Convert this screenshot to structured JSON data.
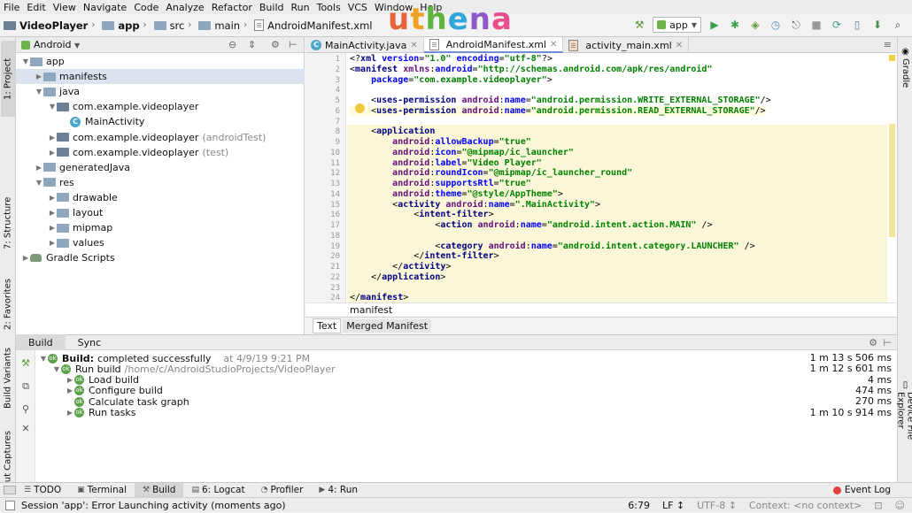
{
  "menu": [
    "File",
    "Edit",
    "View",
    "Navigate",
    "Code",
    "Analyze",
    "Refactor",
    "Build",
    "Run",
    "Tools",
    "VCS",
    "Window",
    "Help"
  ],
  "breadcrumbs": [
    "VideoPlayer",
    "app",
    "src",
    "main",
    "AndroidManifest.xml"
  ],
  "logo": "uthena",
  "run_config": "app",
  "left_strip": {
    "project": "1: Project",
    "structure": "7: Structure",
    "favorites": "2: Favorites",
    "build_variants": "Build Variants",
    "layout_captures": "Layout Captures"
  },
  "right_strip": {
    "gradle": "Gradle",
    "device_explorer": "Device File Explorer"
  },
  "project_panel": {
    "view_selector": "Android",
    "tree": [
      {
        "label": "app",
        "indent": 0,
        "type": "folder"
      },
      {
        "label": "manifests",
        "indent": 1,
        "type": "folder",
        "selected": true
      },
      {
        "label": "java",
        "indent": 1,
        "type": "folder"
      },
      {
        "label": "com.example.videoplayer",
        "indent": 2,
        "type": "package"
      },
      {
        "label": "MainActivity",
        "indent": 3,
        "type": "class"
      },
      {
        "label": "com.example.videoplayer",
        "suffix": "(androidTest)",
        "indent": 2,
        "type": "package"
      },
      {
        "label": "com.example.videoplayer",
        "suffix": "(test)",
        "indent": 2,
        "type": "package"
      },
      {
        "label": "generatedJava",
        "indent": 1,
        "type": "folder"
      },
      {
        "label": "res",
        "indent": 1,
        "type": "folder"
      },
      {
        "label": "drawable",
        "indent": 2,
        "type": "folder"
      },
      {
        "label": "layout",
        "indent": 2,
        "type": "folder"
      },
      {
        "label": "mipmap",
        "indent": 2,
        "type": "folder"
      },
      {
        "label": "values",
        "indent": 2,
        "type": "folder"
      },
      {
        "label": "Gradle Scripts",
        "indent": 0,
        "type": "gradle"
      }
    ]
  },
  "editor_tabs": [
    {
      "label": "MainActivity.java",
      "active": false
    },
    {
      "label": "AndroidManifest.xml",
      "active": true
    },
    {
      "label": "activity_main.xml",
      "active": false
    }
  ],
  "code_lines": [
    "<?xml version=\"1.0\" encoding=\"utf-8\"?>",
    "<manifest xmlns:android=\"http://schemas.android.com/apk/res/android\"",
    "    package=\"com.example.videoplayer\">",
    "",
    "    <uses-permission android:name=\"android.permission.WRITE_EXTERNAL_STORAGE\"/>",
    "    <uses-permission android:name=\"android.permission.READ_EXTERNAL_STORAGE\"/>",
    "",
    "    <application",
    "        android:allowBackup=\"true\"",
    "        android:icon=\"@mipmap/ic_launcher\"",
    "        android:label=\"Video Player\"",
    "        android:roundIcon=\"@mipmap/ic_launcher_round\"",
    "        android:supportsRtl=\"true\"",
    "        android:theme=\"@style/AppTheme\">",
    "        <activity android:name=\".MainActivity\">",
    "            <intent-filter>",
    "                <action android:name=\"android.intent.action.MAIN\" />",
    "",
    "                <category android:name=\"android.intent.category.LAUNCHER\" />",
    "            </intent-filter>",
    "        </activity>",
    "    </application>",
    "",
    "</manifest>"
  ],
  "editor_breadcrumb": "manifest",
  "editor_subtabs": [
    "Text",
    "Merged Manifest"
  ],
  "build_panel": {
    "tabs": [
      "Build",
      "Sync"
    ],
    "rows": [
      {
        "label": "Build:",
        "detail": "completed successfully",
        "extra": "at 4/9/19 9:21 PM",
        "time": "1 m 13 s 506 ms",
        "indent": 0
      },
      {
        "label": "Run build",
        "detail": "/home/c/AndroidStudioProjects/VideoPlayer",
        "time": "1 m 12 s 601 ms",
        "indent": 1
      },
      {
        "label": "Load build",
        "time": "4 ms",
        "indent": 2
      },
      {
        "label": "Configure build",
        "time": "474 ms",
        "indent": 2
      },
      {
        "label": "Calculate task graph",
        "time": "270 ms",
        "indent": 2
      },
      {
        "label": "Run tasks",
        "time": "1 m 10 s 914 ms",
        "indent": 2
      }
    ]
  },
  "bottom_tools": [
    {
      "label": "TODO"
    },
    {
      "label": "Terminal"
    },
    {
      "label": "Build",
      "active": true
    },
    {
      "label": "6: Logcat"
    },
    {
      "label": "Profiler"
    },
    {
      "label": "4: Run"
    }
  ],
  "event_log": "Event Log",
  "status": {
    "message": "Session 'app': Error Launching activity (moments ago)",
    "position": "6:79",
    "line_sep": "LF ↕",
    "encoding": "UTF-8 ↕",
    "context": "Context: <no context>"
  }
}
